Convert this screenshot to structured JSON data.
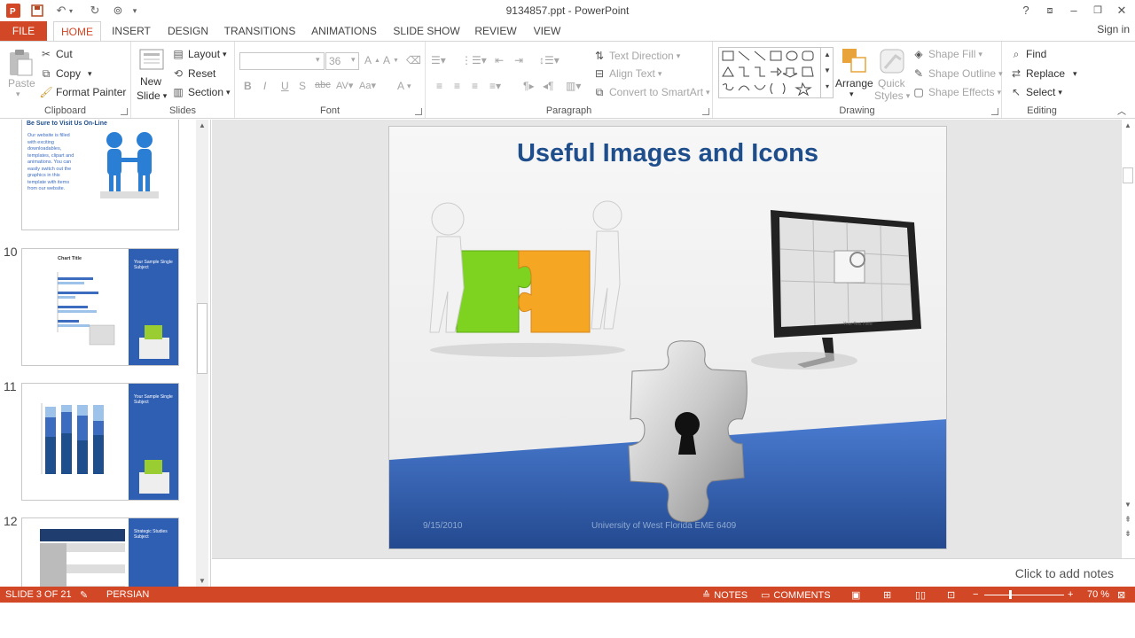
{
  "window": {
    "title": "9134857.ppt - PowerPoint",
    "help": "?",
    "signin": "Sign in"
  },
  "tabs": [
    "FILE",
    "HOME",
    "INSERT",
    "DESIGN",
    "TRANSITIONS",
    "ANIMATIONS",
    "SLIDE SHOW",
    "REVIEW",
    "VIEW"
  ],
  "ribbon": {
    "clipboard": {
      "label": "Clipboard",
      "paste": "Paste",
      "cut": "Cut",
      "copy": "Copy",
      "format_painter": "Format Painter"
    },
    "slides": {
      "label": "Slides",
      "new_slide_1": "New",
      "new_slide_2": "Slide",
      "layout": "Layout",
      "reset": "Reset",
      "section": "Section"
    },
    "font": {
      "label": "Font",
      "font_name": "",
      "font_size": "36"
    },
    "paragraph": {
      "label": "Paragraph",
      "text_direction": "Text Direction",
      "align_text": "Align Text",
      "convert_smartart": "Convert to SmartArt"
    },
    "drawing": {
      "label": "Drawing",
      "arrange": "Arrange",
      "quick_styles_1": "Quick",
      "quick_styles_2": "Styles",
      "shape_fill": "Shape Fill",
      "shape_outline": "Shape Outline",
      "shape_effects": "Shape Effects"
    },
    "editing": {
      "label": "Editing",
      "find": "Find",
      "replace": "Replace",
      "select": "Select"
    }
  },
  "thumbnails": [
    {
      "number": "",
      "title": "Be Sure to Visit Us On-Line",
      "body": "Our website is filled with exciting downloadables, templates, clipart and animations. You can easily switch out the graphics in this template with items from our website."
    },
    {
      "number": "10",
      "title": "Chart Title",
      "side": "Your Sample Single Subject"
    },
    {
      "number": "11",
      "title": "",
      "side": "Your Sample Single Subject"
    },
    {
      "number": "12",
      "title": "",
      "side": "Strategic Studies Subject"
    }
  ],
  "slide": {
    "title": "Useful Images and Icons",
    "date": "9/15/2010",
    "footer": "University of West Florida    EME 6409",
    "monitor_caption": "Your Text Here"
  },
  "notes": {
    "placeholder": "Click to add notes"
  },
  "status": {
    "slide_indicator": "SLIDE 3 OF 21",
    "language": "PERSIAN",
    "notes": "NOTES",
    "comments": "COMMENTS",
    "zoom": "70 %"
  },
  "colors": {
    "accent": "#d24726",
    "title_blue": "#1f4e8c",
    "slide_band": "#3b6cc0"
  }
}
